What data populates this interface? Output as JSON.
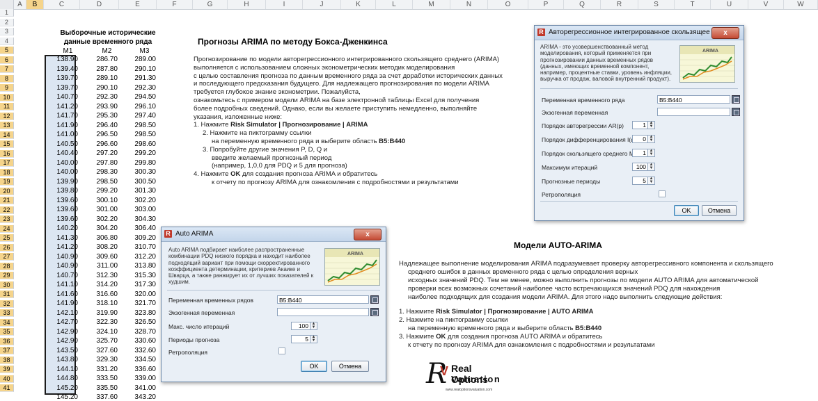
{
  "spreadsheet": {
    "columns": [
      "A",
      "B",
      "C",
      "D",
      "E",
      "F",
      "G",
      "H",
      "I",
      "J",
      "K",
      "L",
      "M",
      "N",
      "O",
      "P",
      "Q",
      "R",
      "S",
      "T",
      "U",
      "V",
      "W"
    ],
    "rows": [
      "1",
      "2",
      "3",
      "4",
      "5",
      "6",
      "7",
      "8",
      "9",
      "10",
      "11",
      "12",
      "13",
      "14",
      "15",
      "16",
      "17",
      "18",
      "19",
      "20",
      "21",
      "22",
      "23",
      "24",
      "25",
      "26",
      "27",
      "28",
      "29",
      "30",
      "31",
      "32",
      "33",
      "34",
      "35",
      "36",
      "37",
      "38",
      "39",
      "40",
      "41"
    ]
  },
  "data_table": {
    "title_line1": "Выборочные исторические",
    "title_line2": "данные временного ряда",
    "headers": [
      "M1",
      "M2",
      "M3"
    ],
    "rows": [
      [
        "138.90",
        "286.70",
        "289.00"
      ],
      [
        "139.40",
        "287.80",
        "290.10"
      ],
      [
        "139.70",
        "289.10",
        "291.30"
      ],
      [
        "139.70",
        "290.10",
        "292.30"
      ],
      [
        "140.70",
        "292.30",
        "294.50"
      ],
      [
        "141.20",
        "293.90",
        "296.10"
      ],
      [
        "141.70",
        "295.30",
        "297.40"
      ],
      [
        "141.90",
        "296.40",
        "298.50"
      ],
      [
        "141.00",
        "296.50",
        "298.50"
      ],
      [
        "140.50",
        "296.60",
        "298.60"
      ],
      [
        "140.40",
        "297.20",
        "299.20"
      ],
      [
        "140.00",
        "297.80",
        "299.80"
      ],
      [
        "140.00",
        "298.30",
        "300.30"
      ],
      [
        "139.90",
        "298.50",
        "300.50"
      ],
      [
        "139.80",
        "299.20",
        "301.30"
      ],
      [
        "139.60",
        "300.10",
        "302.20"
      ],
      [
        "139.60",
        "301.00",
        "303.00"
      ],
      [
        "139.60",
        "302.20",
        "304.30"
      ],
      [
        "140.20",
        "304.20",
        "306.40"
      ],
      [
        "141.30",
        "306.80",
        "309.20"
      ],
      [
        "141.20",
        "308.20",
        "310.70"
      ],
      [
        "140.90",
        "309.60",
        "312.20"
      ],
      [
        "140.90",
        "311.00",
        "313.80"
      ],
      [
        "140.70",
        "312.30",
        "315.30"
      ],
      [
        "141.10",
        "314.20",
        "317.30"
      ],
      [
        "141.60",
        "316.60",
        "320.00"
      ],
      [
        "141.90",
        "318.10",
        "321.70"
      ],
      [
        "142.10",
        "319.90",
        "323.80"
      ],
      [
        "142.70",
        "322.30",
        "326.50"
      ],
      [
        "142.90",
        "324.10",
        "328.70"
      ],
      [
        "142.90",
        "325.70",
        "330.60"
      ],
      [
        "143.50",
        "327.60",
        "332.60"
      ],
      [
        "143.80",
        "329.30",
        "334.50"
      ],
      [
        "144.10",
        "331.20",
        "336.60"
      ],
      [
        "144.80",
        "333.50",
        "339.00"
      ],
      [
        "145.20",
        "335.50",
        "341.00"
      ],
      [
        "145.20",
        "337.60",
        "343.20"
      ]
    ]
  },
  "arima_section": {
    "title": "Прогнозы ARIMA по методу Бокса-Дженкинса",
    "lines": [
      "Прогнозирование по модели авторегрессионного интегрированного скользящего среднего (ARIMA)",
      "выполняется с использованием сложных эконометрических методик моделирования",
      "с целью составления прогноза по данным временного ряда за счет доработки исторических данных",
      "и последующего предсказания будущего. Для надлежащего прогнозирования по модели ARIMA",
      "требуется глубокое знание эконометрии. Пожалуйста,",
      "ознакомьтесь с примером модели ARIMA на базе электронной таблицы Excel для получения",
      "более подробных сведений. Однако, если вы желаете приступить немедленно, выполняйте",
      "указания, изложенные ниже:"
    ],
    "step1_prefix": "1. Нажмите ",
    "step1_bold": "Risk Simulator | Прогнозирование | ARIMA",
    "step2_line1": "2. Нажмите на пиктограмму ссылки",
    "step2_line2_prefix": "на переменную временного ряда и выберите область ",
    "step2_line2_bold": "B5:B440",
    "step3_line1": "3. Попробуйте другие значения P, D, Q и",
    "step3_line2": "введите желаемый прогнозный период",
    "step3_line3": "(например, 1,0,0 для PDQ и 5 для прогноза)",
    "step4_prefix": "4. Нажмите ",
    "step4_bold": "OK",
    "step4_suffix": " для создания прогноза ARIMA и обратитесь",
    "step4_line2": "к отчету по прогнозу ARIMA для ознакомления с подробностями и результатами"
  },
  "auto_section": {
    "title": "Модели AUTO-ARIMA",
    "lines": [
      "Надлежащее выполнение моделирования ARIMA подразумевает проверку авторегрессивного компонента и скользящего",
      "среднего ошибок в данных временного ряда с целью определения верных",
      "исходных значений PDQ. Тем не менее, можно выполнить прогнозы по модели AUTO ARIMA для автоматической",
      "проверки всех возможных сочетаний наиболее часто встречающихся значений PDQ для нахождения",
      "наиболее подходящих для создания модели ARIMA. Для этого надо выполнить следующие действия:"
    ],
    "step1_prefix": "1. Нажмите ",
    "step1_bold": "Risk Simulator | Прогнозирование | AUTO ARIMA",
    "step2_line1": "2. Нажмите на пиктограмму ссылки",
    "step2_line2_prefix": "на переменную временного ряда и выберите область ",
    "step2_line2_bold": "B5:B440",
    "step3_prefix": "3. Нажмите ",
    "step3_bold": "OK",
    "step3_suffix": " для создания прогноза AUTO ARIMA и обратитесь",
    "step3_line2": "к отчету по прогнозу ARIMA для ознакомления с подробностями и результатами"
  },
  "dialog_arima": {
    "title": "Авторегрессионное интегрированное скользящее среднее",
    "close": "x",
    "thumb_label": "ARIMA",
    "description": "ARIMA - это усовершенствованный метод моделирования, который применяется при прогнозировании данных временных рядов (данных, имеющих временной компонент, например, процентные ставки, уровень инфляции, выручка от продаж, валовой внутренний продукт).",
    "series_label": "Переменная временного ряда",
    "series_value": "B5:B440",
    "exog_label": "Экзогенная переменная",
    "exog_value": "",
    "ar_label": "Порядок авторегрессии AR(p)",
    "ar_value": "1",
    "d_label": "Порядок дифференцирования I(d)",
    "d_value": "0",
    "ma_label": "Порядок скользящего среднего MA(q)",
    "ma_value": "1",
    "iter_label": "Максимум итераций",
    "iter_value": "100",
    "periods_label": "Прогнозные периоды",
    "periods_value": "5",
    "backcast_label": "Ретрополяция",
    "ok": "OK",
    "cancel": "Отмена"
  },
  "dialog_auto": {
    "title": "Auto ARIMA",
    "close": "x",
    "thumb_label": "ARIMA",
    "description": "Auto ARIMA подбирает наиболее распространенные комбинации PDQ низкого порядка и находит наиболее подходящий вариант при помощи скорректированного коэффициента детерминации, критериев Акаике и Шварца, а также ранжирует их от лучших показателей к худшим.",
    "series_label": "Переменная временных рядов",
    "series_value": "B5:B440",
    "exog_label": "Экзогенная переменная",
    "exog_value": "",
    "iter_label": "Макс. число итераций",
    "iter_value": "100",
    "periods_label": "Периоды прогноза",
    "periods_value": "5",
    "backcast_label": "Ретрополяция",
    "ok": "OK",
    "cancel": "Отмена"
  },
  "logo": {
    "line1": "Real Options",
    "line2": "Valuation",
    "url": "www.realoptionsvaluation.com"
  },
  "colors": {
    "selection_fill": "#dce6f2",
    "header_highlight": "#f5d48b",
    "dialog_bg": "#e9eff6",
    "logo_accent": "#c0392b"
  }
}
